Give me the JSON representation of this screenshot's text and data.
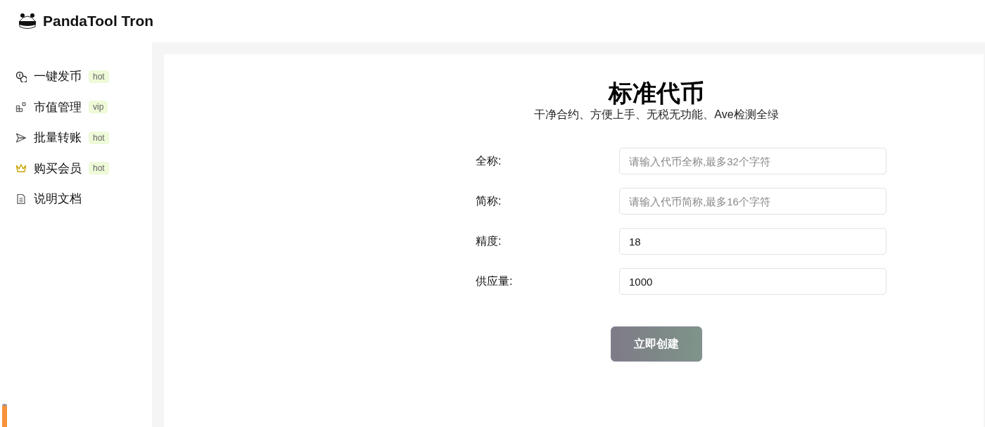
{
  "app": {
    "title": "PandaTool Tron"
  },
  "sidebar": {
    "items": [
      {
        "kind": "coins",
        "label": "一键发币",
        "badge": "hot"
      },
      {
        "kind": "grid",
        "label": "市值管理",
        "badge": "vip"
      },
      {
        "kind": "send",
        "label": "批量转账",
        "badge": "hot"
      },
      {
        "kind": "crown",
        "label": "购买会员",
        "badge": "hot"
      },
      {
        "kind": "document",
        "label": "说明文档"
      }
    ]
  },
  "form": {
    "title": "标准代币",
    "subtitle": "干净合约、方便上手、无税无功能、Ave检测全绿",
    "fields": [
      {
        "label": "全称:",
        "placeholder": "请输入代币全称,最多32个字符"
      },
      {
        "label": "简称:",
        "placeholder": "请输入代币简称,最多16个字符"
      },
      {
        "label": "精度:",
        "value": "18"
      },
      {
        "label": "供应量:",
        "value": "1000"
      }
    ],
    "submit": "立即创建"
  }
}
